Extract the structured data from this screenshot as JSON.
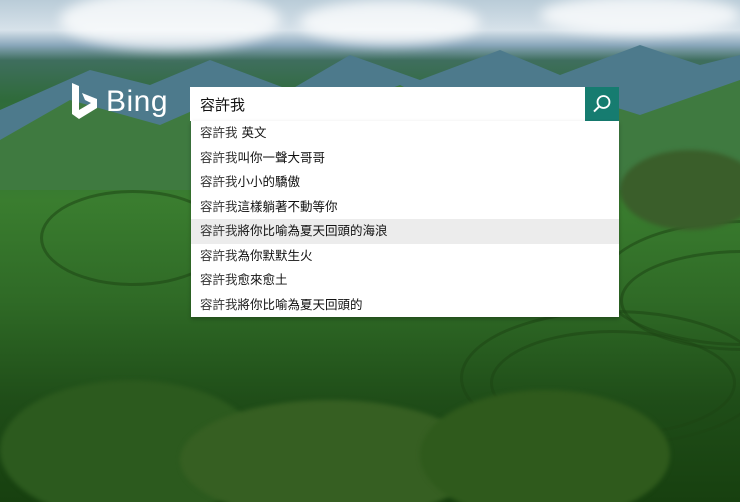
{
  "brand": {
    "name": "Bing"
  },
  "search": {
    "value": "容許我",
    "button_icon": "search-icon"
  },
  "suggestions": [
    {
      "typed": "容許我",
      "rest": " 英文"
    },
    {
      "typed": "容許我",
      "rest": "叫你一聲大哥哥"
    },
    {
      "typed": "容許我",
      "rest": "小小的驕傲"
    },
    {
      "typed": "容許我",
      "rest": "這樣躺著不動等你"
    },
    {
      "typed": "容許我",
      "rest": "將你比喻為夏天回頭的海浪"
    },
    {
      "typed": "容許我",
      "rest": "為你默默生火"
    },
    {
      "typed": "容許我",
      "rest": "愈來愈土"
    },
    {
      "typed": "容許我",
      "rest": "將你比喻為夏天回頭的"
    }
  ],
  "colors": {
    "accent": "#167c70",
    "hover_row": "#ececec"
  }
}
